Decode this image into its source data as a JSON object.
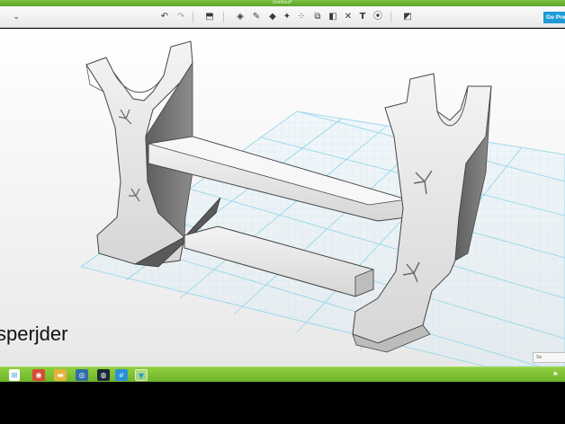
{
  "window": {
    "title": "Untitled*"
  },
  "toolbar": {
    "menu_icon": "chevron-down-icon",
    "go_label": "Go Premium",
    "icons": [
      {
        "name": "undo-icon",
        "glyph": "↶"
      },
      {
        "name": "redo-icon",
        "glyph": "↷"
      },
      {
        "name": "import-icon",
        "glyph": "⬒"
      },
      {
        "name": "primitives-icon",
        "glyph": "◈"
      },
      {
        "name": "sketch-icon",
        "glyph": "✎"
      },
      {
        "name": "construct-icon",
        "glyph": "◆"
      },
      {
        "name": "modify-icon",
        "glyph": "✦"
      },
      {
        "name": "pattern-icon",
        "glyph": "⁘"
      },
      {
        "name": "group-icon",
        "glyph": "⧉"
      },
      {
        "name": "combine-icon",
        "glyph": "◧"
      },
      {
        "name": "measure-icon",
        "glyph": "✕"
      },
      {
        "name": "text-icon",
        "glyph": "T"
      },
      {
        "name": "snap-icon",
        "glyph": "⦿"
      },
      {
        "name": "material-icon",
        "glyph": "◩"
      }
    ]
  },
  "viewport": {
    "caption": "sperjder",
    "corner_label": "Se"
  },
  "taskbar": {
    "icons": [
      {
        "name": "windows-start-icon",
        "glyph": "⊞"
      },
      {
        "name": "chrome-icon",
        "glyph": "◉"
      },
      {
        "name": "folder-icon",
        "glyph": "▬"
      },
      {
        "name": "app-icon",
        "glyph": "◎"
      },
      {
        "name": "steam-icon",
        "glyph": "◍"
      },
      {
        "name": "edge-icon",
        "glyph": "ℯ"
      },
      {
        "name": "123d-design-icon",
        "glyph": "▼"
      }
    ],
    "tray_icon": "flag-icon"
  },
  "colors": {
    "titlebar": "#6cb434",
    "accent": "#1e9ad6",
    "grid": "#8fd3ea",
    "taskbar": "#7dc235"
  }
}
